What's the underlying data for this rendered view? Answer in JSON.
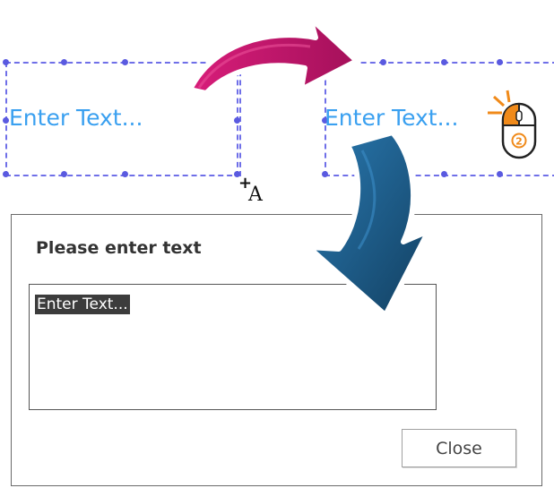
{
  "canvas": {
    "left_textbox": {
      "text": "Enter Text..."
    },
    "right_textbox": {
      "text": "Enter Text..."
    }
  },
  "cursor": {
    "glyph": "+A",
    "plus": "+",
    "letter": "A"
  },
  "icons": {
    "pink_arrow": "curved-arrow-right-icon",
    "blue_arrow": "curved-arrow-down-icon",
    "mouse": "mouse-double-click-icon",
    "mouse_badge": "②"
  },
  "colors": {
    "handle_blue": "#6f6fe8",
    "text_blue": "#3aa0f0",
    "arrow_pink": "#c0166a",
    "arrow_blue": "#1d5f8c",
    "accent_orange": "#f08a1a"
  },
  "dialog": {
    "title": "Please enter text",
    "textarea_value": "Enter Text...",
    "close_label": "Close"
  }
}
